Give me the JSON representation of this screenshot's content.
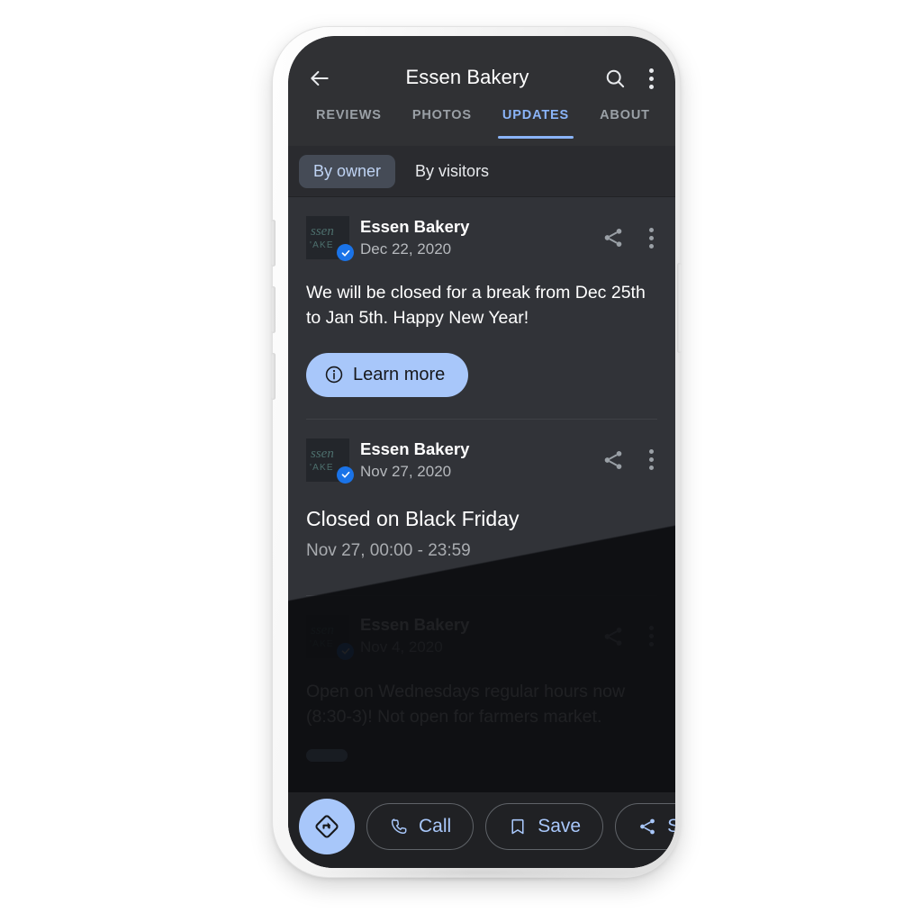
{
  "app_bar": {
    "back_icon": "back-arrow-icon",
    "title": "Essen Bakery",
    "search_icon": "search-icon",
    "overflow_icon": "more-vertical-icon"
  },
  "tabs": [
    {
      "label": "REVIEWS",
      "active": false
    },
    {
      "label": "PHOTOS",
      "active": false
    },
    {
      "label": "UPDATES",
      "active": true
    },
    {
      "label": "ABOUT",
      "active": false
    }
  ],
  "filter_chips": [
    {
      "label": "By owner",
      "selected": true
    },
    {
      "label": "By visitors",
      "selected": false
    }
  ],
  "posts": [
    {
      "author": "Essen Bakery",
      "date": "Dec 22, 2020",
      "body": "We will be closed for a break from Dec 25th to Jan 5th. Happy New Year!",
      "cta_label": "Learn more",
      "cta_icon": "info-icon",
      "share_icon": "share-icon",
      "overflow_icon": "more-vertical-icon",
      "verified": true
    },
    {
      "author": "Essen Bakery",
      "date": "Nov 27, 2020",
      "title": "Closed on Black Friday",
      "subtitle": "Nov 27, 00:00 - 23:59",
      "share_icon": "share-icon",
      "overflow_icon": "more-vertical-icon",
      "verified": true
    },
    {
      "author": "Essen Bakery",
      "date": "Nov 4, 2020",
      "body": "Open on Wednesdays regular hours now (8:30-3)! Not open for farmers market.",
      "share_icon": "share-icon",
      "overflow_icon": "more-vertical-icon",
      "verified": true
    }
  ],
  "avatar": {
    "logo_line_1": "ssen",
    "logo_line_2": "AKE",
    "alt": "Essen Bakery logo"
  },
  "bottom_bar": {
    "directions_label": "",
    "directions_icon": "directions-icon",
    "actions": [
      {
        "label": "Call",
        "icon": "phone-icon"
      },
      {
        "label": "Save",
        "icon": "bookmark-icon"
      },
      {
        "label": "Share",
        "icon": "share-icon"
      }
    ]
  },
  "colors": {
    "accent_blue": "#8ab4f8",
    "cta_blue": "#a8c7fa",
    "app_bar_bg": "#303134",
    "feed_bg": "#313338",
    "bottom_bar_bg": "#202124",
    "chip_selected_bg": "#454b56",
    "verified_badge": "#1a73e8",
    "muted_text": "#9aa0a6"
  }
}
